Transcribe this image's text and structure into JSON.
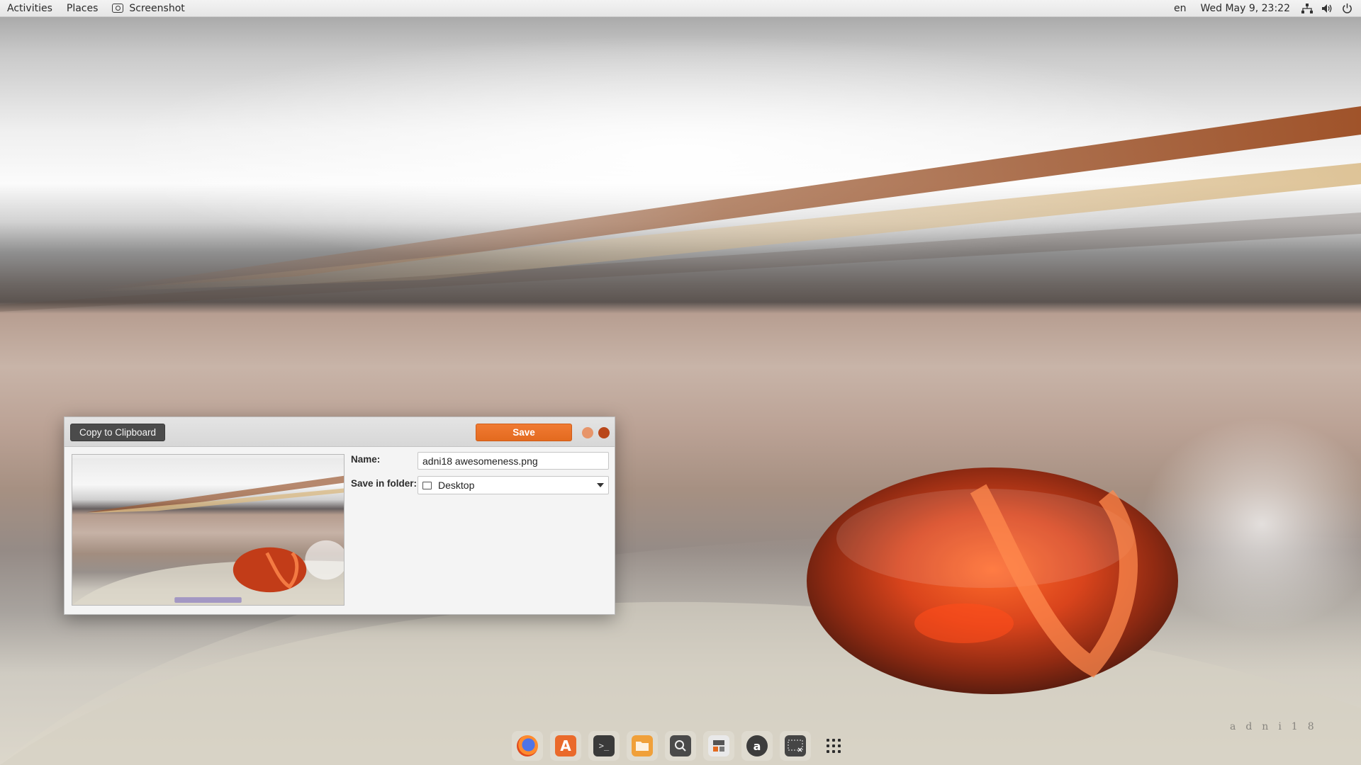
{
  "topbar": {
    "activities": "Activities",
    "places": "Places",
    "app_name": "Screenshot",
    "app_icon": "camera-icon",
    "keyboard_layout": "en",
    "clock": "Wed May 9, 23:22",
    "tray_icons": [
      "network-icon",
      "volume-icon",
      "power-icon"
    ]
  },
  "dialog": {
    "copy_button": "Copy to Clipboard",
    "save_button": "Save",
    "name_label": "Name:",
    "name_value": "adni18 awesomeness.png",
    "folder_label": "Save in folder:",
    "folder_value": "Desktop",
    "window_buttons": [
      "minimize-icon",
      "close-icon"
    ]
  },
  "dock": {
    "items": [
      {
        "name": "firefox",
        "icon": "firefox-icon"
      },
      {
        "name": "software-store",
        "icon": "store-icon",
        "glyph": "A"
      },
      {
        "name": "terminal",
        "icon": "terminal-icon",
        "glyph": ">_"
      },
      {
        "name": "files",
        "icon": "folder-icon"
      },
      {
        "name": "search",
        "icon": "search-icon"
      },
      {
        "name": "apps",
        "icon": "apps-icon"
      },
      {
        "name": "amazon",
        "icon": "amazon-icon",
        "glyph": "a"
      },
      {
        "name": "screenshot",
        "icon": "screenshot-icon"
      }
    ],
    "show_apps_icon": "grid-icon"
  },
  "wallpaper": {
    "signature": "adni18",
    "accent_color": "#e36a1f"
  }
}
